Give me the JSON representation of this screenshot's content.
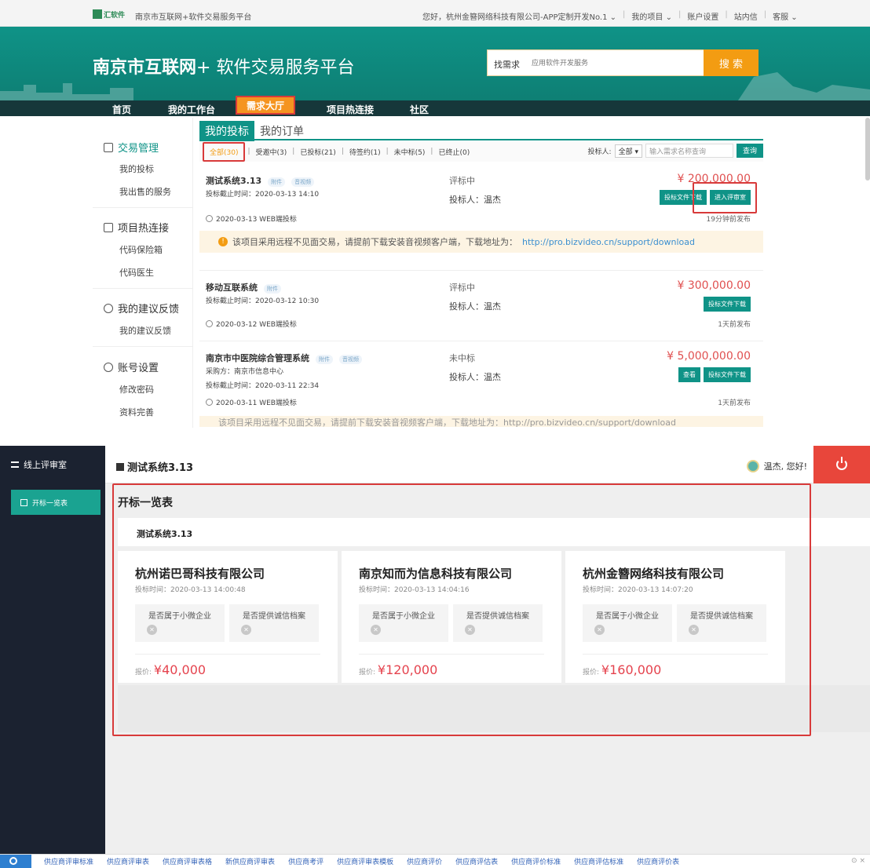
{
  "topbar": {
    "logo_text": "汇软件",
    "site": "南京市互联网+软件交易服务平台",
    "greeting": "您好，杭州金簪网络科技有限公司-APP定制开发No.1 ⌄",
    "my_projects": "我的项目 ⌄",
    "account": "账户设置",
    "inbox": "站内信",
    "service": "客服 ⌄"
  },
  "header": {
    "title_bold": "南京市互联网",
    "title_rest": "+ 软件交易服务平台",
    "search_label": "找需求",
    "search_placeholder": "应用软件开发服务",
    "search_button": "搜 索"
  },
  "nav": [
    "首页",
    "我的工作台",
    "需求大厅",
    "项目热连接",
    "社区"
  ],
  "sidebar": {
    "groups": [
      {
        "label": "交易管理",
        "items": [
          "我的投标",
          "我出售的服务"
        ]
      },
      {
        "label": "项目热连接",
        "items": [
          "代码保险箱",
          "代码医生"
        ]
      },
      {
        "label": "我的建议反馈",
        "items": [
          "我的建议反馈"
        ]
      },
      {
        "label": "账号设置",
        "items": [
          "修改密码",
          "资料完善"
        ]
      }
    ]
  },
  "content_tabs": [
    "我的投标",
    "我的订单"
  ],
  "filters": {
    "all": "全部(30)",
    "others": [
      "受邀中(3)",
      "已投标(21)",
      "待签约(1)",
      "未中标(5)",
      "已终止(0)"
    ],
    "bidder_label": "投标人:",
    "bidder_value": "全部 ▾",
    "query_placeholder": "输入需求名称查询",
    "query_button": "查询"
  },
  "items": [
    {
      "name": "测试系统3.13",
      "tags": [
        "附件",
        "音视频"
      ],
      "buyer": "",
      "deadline": "投标截止时间：2020-03-13 14:10",
      "status": "评标中",
      "bidder": "投标人：温杰",
      "price": "¥ 200,000.00",
      "buttons": [
        "投标文件下载",
        "进入评审室"
      ],
      "date": "2020-03-13 WEB端投标",
      "published": "19分钟前发布"
    },
    {
      "name": "移动互联系统",
      "tags": [
        "附件"
      ],
      "buyer": "",
      "deadline": "投标截止时间：2020-03-12 10:30",
      "status": "评标中",
      "bidder": "投标人：温杰",
      "price": "¥ 300,000.00",
      "buttons": [
        "投标文件下载"
      ],
      "date": "2020-03-12 WEB端投标",
      "published": "1天前发布"
    },
    {
      "name": "南京市中医院综合管理系统",
      "tags": [
        "附件",
        "音视频"
      ],
      "buyer": "采购方：南京市信息中心",
      "deadline": "投标截止时间：2020-03-11 22:34",
      "status": "未中标",
      "bidder": "投标人：温杰",
      "price": "¥ 5,000,000.00",
      "buttons": [
        "查看",
        "投标文件下载"
      ],
      "date": "2020-03-11 WEB端投标",
      "published": "1天前发布"
    }
  ],
  "notice": {
    "text": "该项目采用远程不见面交易，请提前下载安装音视频客户端，下载地址为：",
    "link": "http://pro.bizvideo.cn/support/download"
  },
  "notice2_text": "该项目采用远程不见面交易，请提前下载安装音视频客户端，下载地址为：http://pro.bizvideo.cn/support/download",
  "review": {
    "sidebar_title": "线上评审室",
    "sidebar_item": "开标一览表",
    "page_title": "测试系统3.13",
    "user": "温杰, 您好!",
    "section_title": "开标一览表",
    "project": "测试系统3.13",
    "question_small": "是否属于小微企业",
    "question_credit": "是否提供诚信档案",
    "price_label": "报价:",
    "bidders": [
      {
        "company": "杭州诺巴哥科技有限公司",
        "time": "投标时间：2020-03-13 14:00:48",
        "price": "¥40,000"
      },
      {
        "company": "南京知而为信息科技有限公司",
        "time": "投标时间：2020-03-13 14:04:16",
        "price": "¥120,000"
      },
      {
        "company": "杭州金簪网络科技有限公司",
        "time": "投标时间：2020-03-13 14:07:20",
        "price": "¥160,000"
      }
    ]
  },
  "bottom_keywords": [
    "供应商评审标准",
    "供应商评审表",
    "供应商评审表格",
    "新供应商评审表",
    "供应商考评",
    "供应商评审表模板",
    "供应商评价",
    "供应商评估表",
    "供应商评价标准",
    "供应商评估标准",
    "供应商评价表"
  ]
}
